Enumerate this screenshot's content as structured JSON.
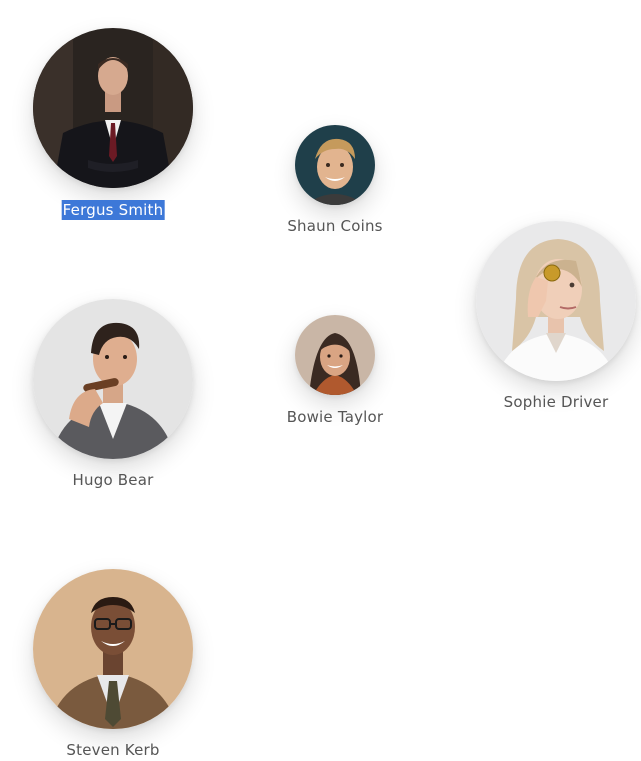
{
  "team": {
    "selection_color": "#3d78d8",
    "name_color": "#555555",
    "members": [
      {
        "name": "Fergus Smith",
        "photo_icon": "man-in-dark-suit-photo"
      },
      {
        "name": "Shaun Coins",
        "photo_icon": "smiling-young-man-photo"
      },
      {
        "name": "Sophie Driver",
        "photo_icon": "blonde-woman-holding-coin-photo"
      },
      {
        "name": "Hugo Bear",
        "photo_icon": "man-with-cigar-photo"
      },
      {
        "name": "Bowie Taylor",
        "photo_icon": "smiling-woman-photo"
      },
      {
        "name": "Steven Kerb",
        "photo_icon": "man-in-glasses-tweed-jacket-photo"
      }
    ]
  }
}
